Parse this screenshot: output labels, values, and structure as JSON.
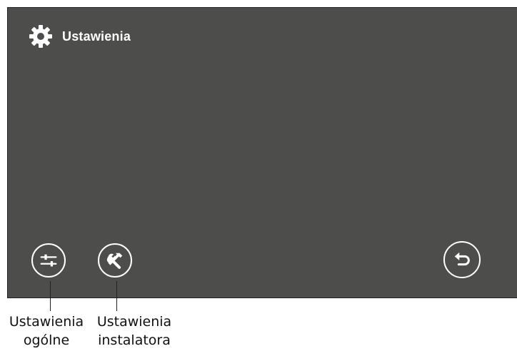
{
  "header": {
    "title": "Ustawienia",
    "icon": "gear-icon"
  },
  "buttons": {
    "general": {
      "icon": "sliders-icon"
    },
    "installer": {
      "icon": "tools-icon"
    },
    "back": {
      "icon": "return-arrow-icon"
    }
  },
  "captions": {
    "general_line1": "Ustawienia",
    "general_line2": "ogólne",
    "installer_line1": "Ustawienia",
    "installer_line2": "instalatora"
  },
  "colors": {
    "screen_bg": "#4d4d4c",
    "icon_fg": "#ffffff"
  }
}
